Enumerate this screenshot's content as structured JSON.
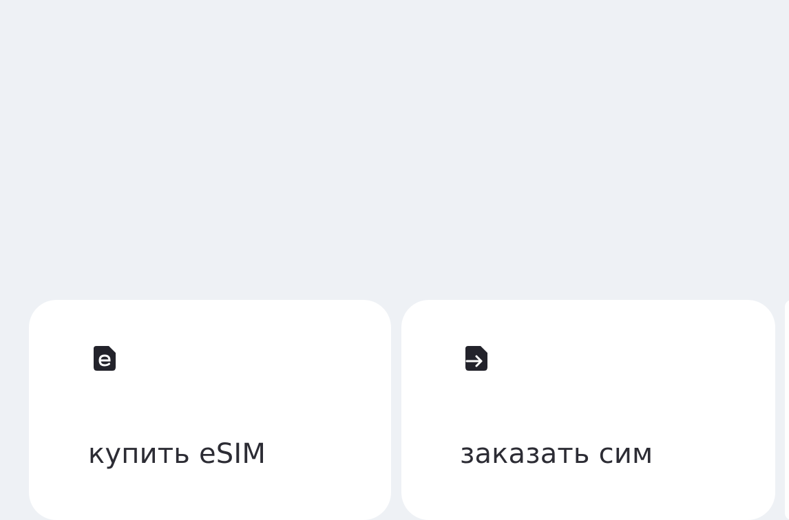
{
  "colors": {
    "page_background": "#eef1f5",
    "card_background": "#ffffff",
    "text": "#2c2c34",
    "icon": "#23232b"
  },
  "cards": [
    {
      "label": "купить eSIM",
      "icon": "esim-card-icon"
    },
    {
      "label": "заказать сим",
      "icon": "sim-card-arrow-icon"
    }
  ]
}
